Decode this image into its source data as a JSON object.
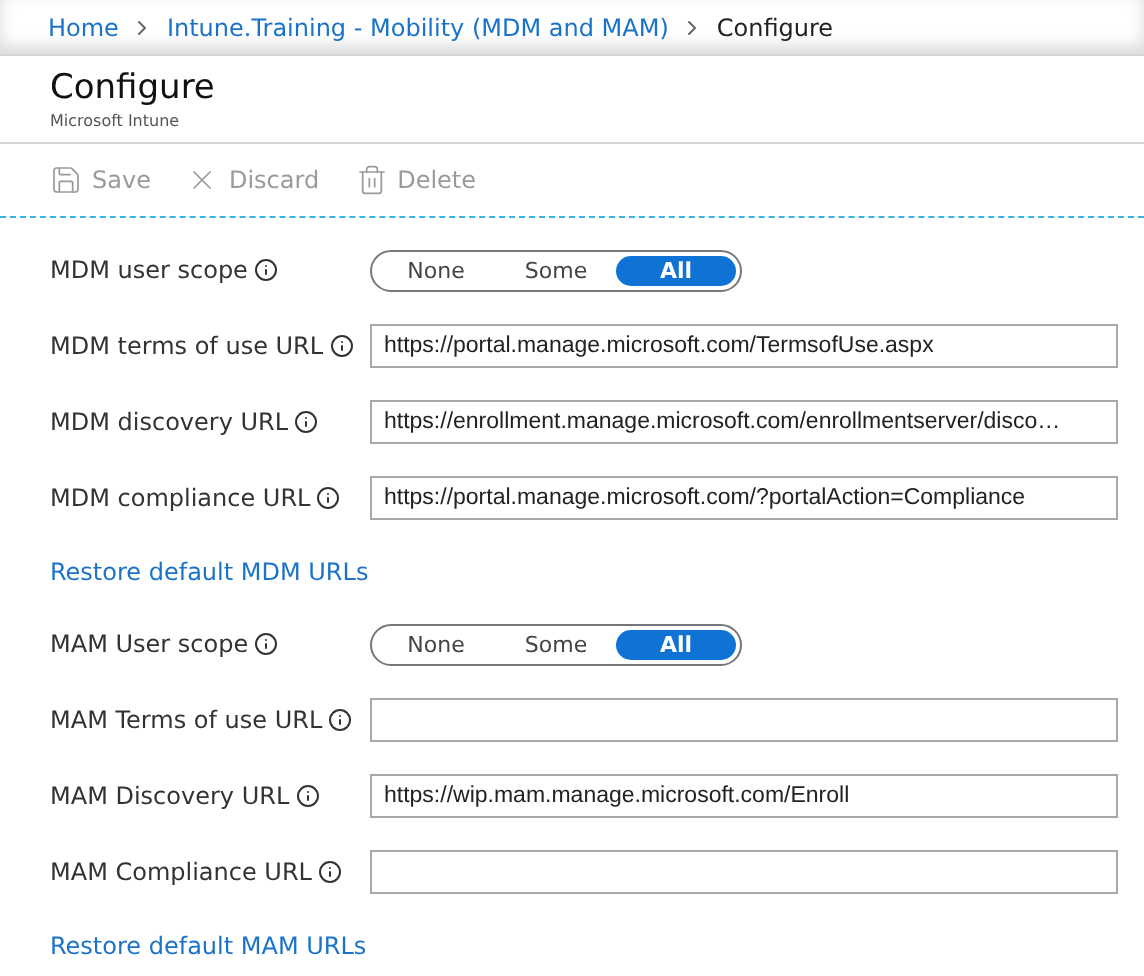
{
  "breadcrumb": [
    {
      "label": "Home",
      "current": false
    },
    {
      "label": "Intune.Training - Mobility (MDM and MAM)",
      "current": false
    },
    {
      "label": "Configure",
      "current": true
    }
  ],
  "header": {
    "title": "Configure",
    "subtitle": "Microsoft Intune"
  },
  "toolbar": [
    {
      "kind": "save",
      "label": "Save",
      "disabled": true
    },
    {
      "kind": "discard",
      "label": "Discard",
      "disabled": true
    },
    {
      "kind": "delete",
      "label": "Delete",
      "disabled": true
    }
  ],
  "sections": [
    {
      "rows": [
        {
          "kind": "scope",
          "label": "MDM user scope",
          "options": [
            {
              "label": "None",
              "selected": false
            },
            {
              "label": "Some",
              "selected": false
            },
            {
              "label": "All",
              "selected": true
            }
          ]
        },
        {
          "kind": "url",
          "label": "MDM terms of use URL",
          "value": "https://portal.manage.microsoft.com/TermsofUse.aspx"
        },
        {
          "kind": "url",
          "label": "MDM discovery URL",
          "value": "https://enrollment.manage.microsoft.com/enrollmentserver/disco…"
        },
        {
          "kind": "url",
          "label": "MDM compliance URL",
          "value": "https://portal.manage.microsoft.com/?portalAction=Compliance"
        }
      ],
      "link": "Restore default MDM URLs"
    },
    {
      "rows": [
        {
          "kind": "scope",
          "label": "MAM User scope",
          "options": [
            {
              "label": "None",
              "selected": false
            },
            {
              "label": "Some",
              "selected": false
            },
            {
              "label": "All",
              "selected": true
            }
          ]
        },
        {
          "kind": "url",
          "label": "MAM Terms of use URL",
          "value": ""
        },
        {
          "kind": "url",
          "label": "MAM Discovery URL",
          "value": "https://wip.mam.manage.microsoft.com/Enroll"
        },
        {
          "kind": "url",
          "label": "MAM Compliance URL",
          "value": ""
        }
      ],
      "link": "Restore default MAM URLs"
    }
  ]
}
